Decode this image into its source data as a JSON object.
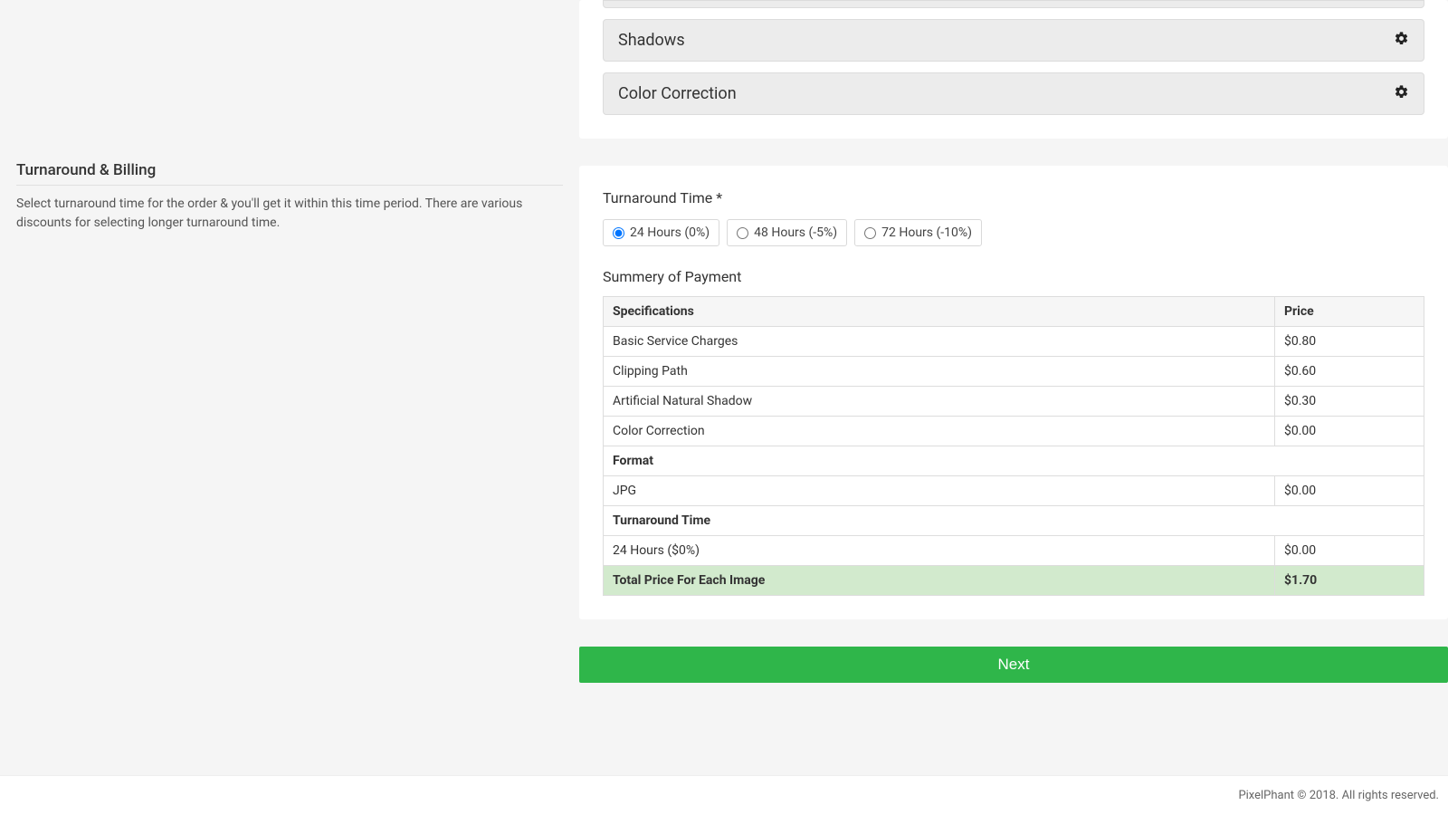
{
  "options_panel": {
    "items": [
      {
        "label": "Shadows"
      },
      {
        "label": "Color Correction"
      }
    ]
  },
  "left": {
    "title": "Turnaround & Billing",
    "desc": "Select turnaround time for the order & you'll get it within this time period. There are various discounts for selecting longer turnaround time."
  },
  "turnaround": {
    "label": "Turnaround Time *",
    "options": [
      {
        "label": "24 Hours (0%)",
        "checked": true
      },
      {
        "label": "48 Hours (-5%)",
        "checked": false
      },
      {
        "label": "72 Hours (-10%)",
        "checked": false
      }
    ]
  },
  "summary": {
    "title": "Summery of Payment",
    "col_spec": "Specifications",
    "col_price": "Price",
    "rows": [
      {
        "spec": "Basic Service Charges",
        "price": "$0.80"
      },
      {
        "spec": "Clipping Path",
        "price": "$0.60"
      },
      {
        "spec": "Artificial Natural Shadow",
        "price": "$0.30"
      },
      {
        "spec": "Color Correction",
        "price": "$0.00"
      }
    ],
    "format_header": "Format",
    "format_row": {
      "spec": "JPG",
      "price": "$0.00"
    },
    "tat_header": "Turnaround Time",
    "tat_row": {
      "spec": "24 Hours ($0%)",
      "price": "$0.00"
    },
    "total": {
      "label": "Total Price For Each Image",
      "price": "$1.70"
    }
  },
  "next_label": "Next",
  "footer": "PixelPhant © 2018. All rights reserved."
}
